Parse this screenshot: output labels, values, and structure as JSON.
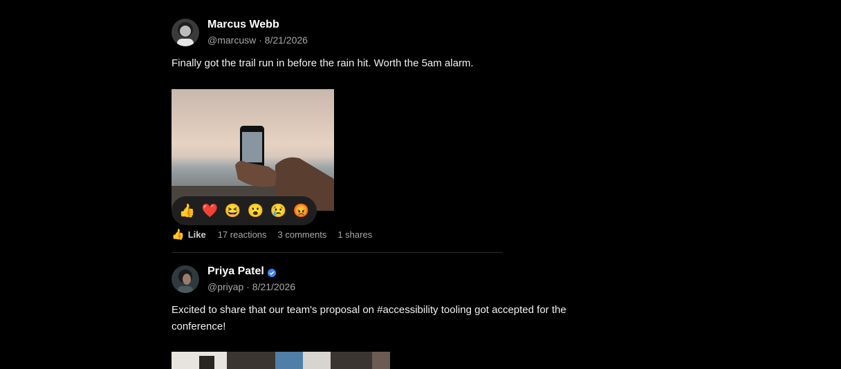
{
  "posts": [
    {
      "author": "Marcus Webb",
      "handle": "@marcusw",
      "date": "8/21/2026",
      "meta_sep": "·",
      "text": "Finally got the trail run in before the rain hit. Worth the 5am alarm.",
      "reactions": [
        "👍",
        "❤️",
        "😆",
        "😮",
        "😢",
        "😡"
      ],
      "like_label": "Like",
      "like_icon": "👍",
      "reactions_count": "17 reactions",
      "comments_count": "3 comments",
      "shares_count": "1 shares"
    },
    {
      "author": "Priya Patel",
      "verified": true,
      "handle": "@priyap",
      "date": "8/21/2026",
      "meta_sep": "·",
      "text": "Excited to share that our team's proposal on #accessibility tooling got accepted for the conference!"
    }
  ],
  "colors": {
    "background": "#000000",
    "muted_text": "#a8a8a8",
    "verified": "#3b82f6",
    "reaction_bar": "#1f1f1f"
  }
}
